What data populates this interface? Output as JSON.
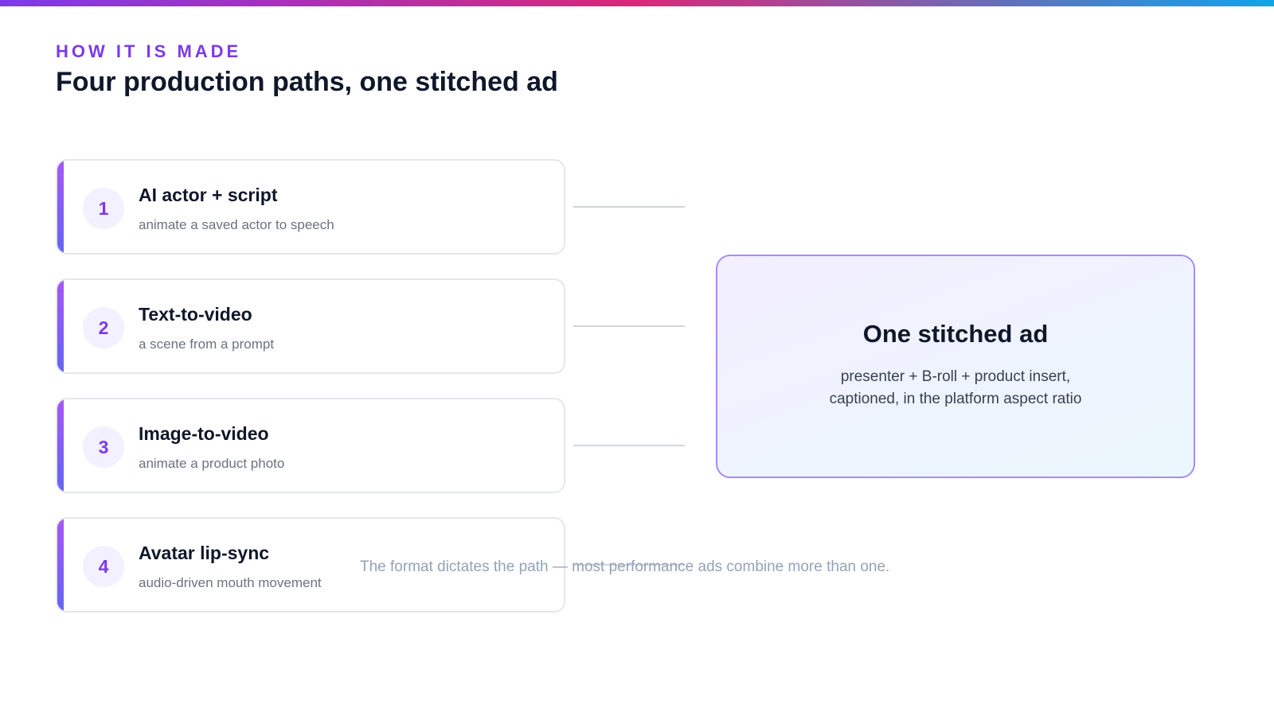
{
  "header": {
    "eyebrow": "HOW IT IS MADE",
    "title": "Four production paths, one stitched ad"
  },
  "paths": [
    {
      "number": "1",
      "title": "AI actor + script",
      "subtitle": "animate a saved actor to speech"
    },
    {
      "number": "2",
      "title": "Text-to-video",
      "subtitle": "a scene from a prompt"
    },
    {
      "number": "3",
      "title": "Image-to-video",
      "subtitle": "animate a product photo"
    },
    {
      "number": "4",
      "title": "Avatar lip-sync",
      "subtitle": "audio-driven mouth movement"
    }
  ],
  "output": {
    "title": "One stitched ad",
    "line1": "presenter + B-roll + product insert,",
    "line2": "captioned, in the platform aspect ratio"
  },
  "footnote": "The format dictates the path — most performance ads combine more than one.",
  "colors": {
    "accent": "#7c3aed",
    "heading": "#0f172a",
    "muted": "#6b7280",
    "output_border": "#a78bfa"
  }
}
